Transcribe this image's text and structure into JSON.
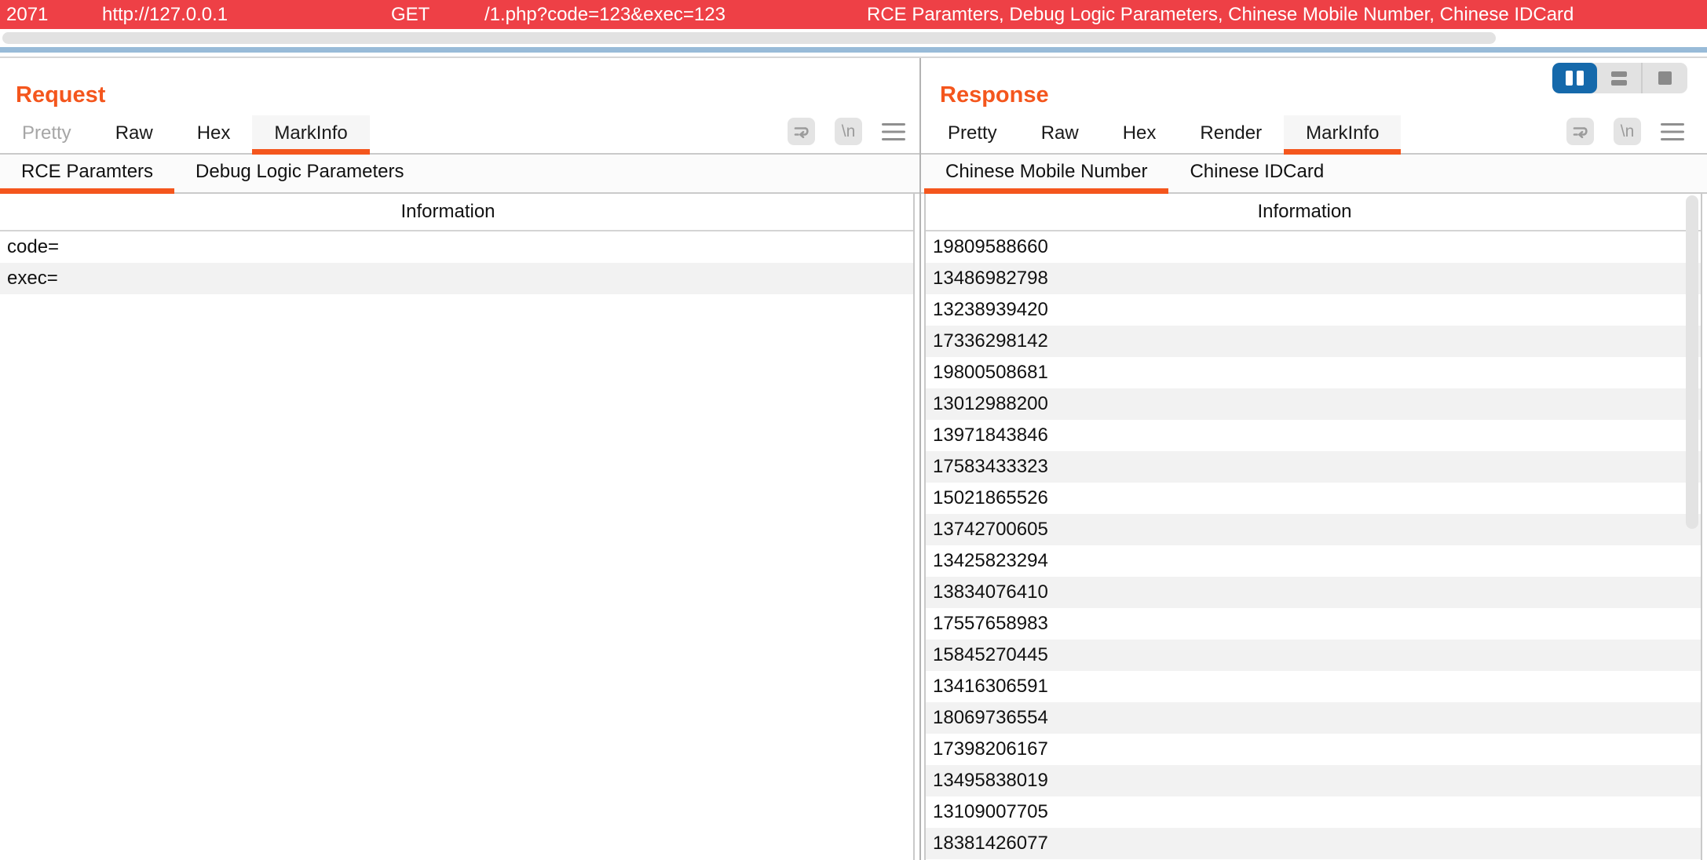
{
  "topbar": {
    "id": "2071",
    "url": "http://127.0.0.1",
    "method": "GET",
    "path": "/1.php?code=123&exec=123",
    "tags": "RCE Paramters, Debug Logic Parameters, Chinese Mobile Number, Chinese IDCard"
  },
  "request": {
    "title": "Request",
    "tabs": [
      {
        "label": "Pretty",
        "state": "disabled"
      },
      {
        "label": "Raw"
      },
      {
        "label": "Hex"
      },
      {
        "label": "MarkInfo",
        "state": "selected"
      }
    ],
    "subtabs": [
      {
        "label": "RCE Paramters",
        "state": "selected"
      },
      {
        "label": "Debug Logic Parameters"
      }
    ],
    "table": {
      "header": "Information",
      "rows": [
        "code=",
        "exec="
      ]
    }
  },
  "response": {
    "title": "Response",
    "tabs": [
      {
        "label": "Pretty"
      },
      {
        "label": "Raw"
      },
      {
        "label": "Hex"
      },
      {
        "label": "Render"
      },
      {
        "label": "MarkInfo",
        "state": "selected"
      }
    ],
    "subtabs": [
      {
        "label": "Chinese Mobile Number",
        "state": "selected"
      },
      {
        "label": "Chinese IDCard"
      }
    ],
    "table": {
      "header": "Information",
      "rows": [
        "19809588660",
        "13486982798",
        "13238939420",
        "17336298142",
        "19800508681",
        "13012988200",
        "13971843846",
        "17583433323",
        "15021865526",
        "13742700605",
        "13425823294",
        "13834076410",
        "17557658983",
        "15845270445",
        "13416306591",
        "18069736554",
        "17398206167",
        "13495838019",
        "13109007705",
        "18381426077"
      ]
    }
  },
  "icons": {
    "newline_label": "\\n"
  },
  "layout_switcher": {
    "selected": "split-columns",
    "buttons": [
      "split-columns",
      "stacked-rows",
      "single-view"
    ]
  },
  "colors": {
    "accent_orange": "#f4561d",
    "selected_row_red": "#ee4046",
    "selection_blue": "#1569ab",
    "row_stripe": "#f2f2f2",
    "focus_line_blue": "#98bbd8"
  }
}
